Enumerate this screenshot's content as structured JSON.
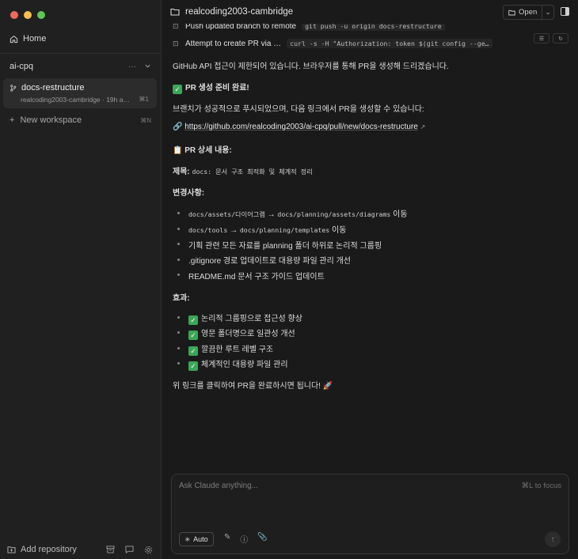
{
  "sidebar": {
    "home_label": "Home",
    "project_name": "ai-cpq",
    "project_more": "···",
    "workspace": {
      "title": "docs-restructure",
      "subtitle": "realcoding2003-cambridge · 19h a…",
      "shortcut": "⌘1"
    },
    "new_workspace_label": "New workspace",
    "new_workspace_shortcut": "⌘N",
    "add_repository_label": "Add repository"
  },
  "topbar": {
    "path": "realcoding2003-cambridge",
    "open_label": "Open"
  },
  "conversation": {
    "tool_calls": [
      {
        "label": "Push updated branch to remote",
        "code": "git push -u origin docs-restructure"
      },
      {
        "label": "Attempt to create PR via …",
        "code": "curl -s -H \"Authorization: token $(git config --ge…"
      }
    ],
    "intro": "GitHub API 접근이 제한되어 있습니다. 브라우저를 통해 PR을 생성해 드리겠습니다.",
    "ready_heading": "PR 생성 준비 완료!",
    "pushed_text": "브랜치가 성공적으로 푸시되었으며, 다음 링크에서 PR을 생성할 수 있습니다:",
    "pr_link": "https://github.com/realcoding2003/ai-cpq/pull/new/docs-restructure",
    "details_heading": "PR 상세 내용:",
    "title_label": "제목:",
    "title_value": "docs: 문서 구조 최적화 및 체계적 정리",
    "changes_label": "변경사항:",
    "changes": [
      {
        "from": "docs/assets/다이어그램",
        "arrow": "→",
        "to": "docs/planning/assets/diagrams",
        "suffix": "이동"
      },
      {
        "from": "docs/tools",
        "arrow": "→",
        "to": "docs/planning/templates",
        "suffix": "이동"
      }
    ],
    "changes_plain": [
      "기획 관련 모든 자료를 planning 폴더 하위로 논리적 그룹핑",
      ".gitignore 경로 업데이트로 대용량 파일 관리 개선",
      "README.md 문서 구조 가이드 업데이트"
    ],
    "effects_label": "효과:",
    "effects": [
      "논리적 그룹핑으로 접근성 향상",
      "영문 폴더명으로 일관성 개선",
      "깔끔한 루트 레벨 구조",
      "체계적인 대용량 파일 관리"
    ],
    "closing": "위 링크를 클릭하여 PR을 완료하시면 됩니다! 🚀"
  },
  "composer": {
    "placeholder": "Ask Claude anything...",
    "focus_hint": "⌘L to focus",
    "mode_label": "Auto"
  }
}
